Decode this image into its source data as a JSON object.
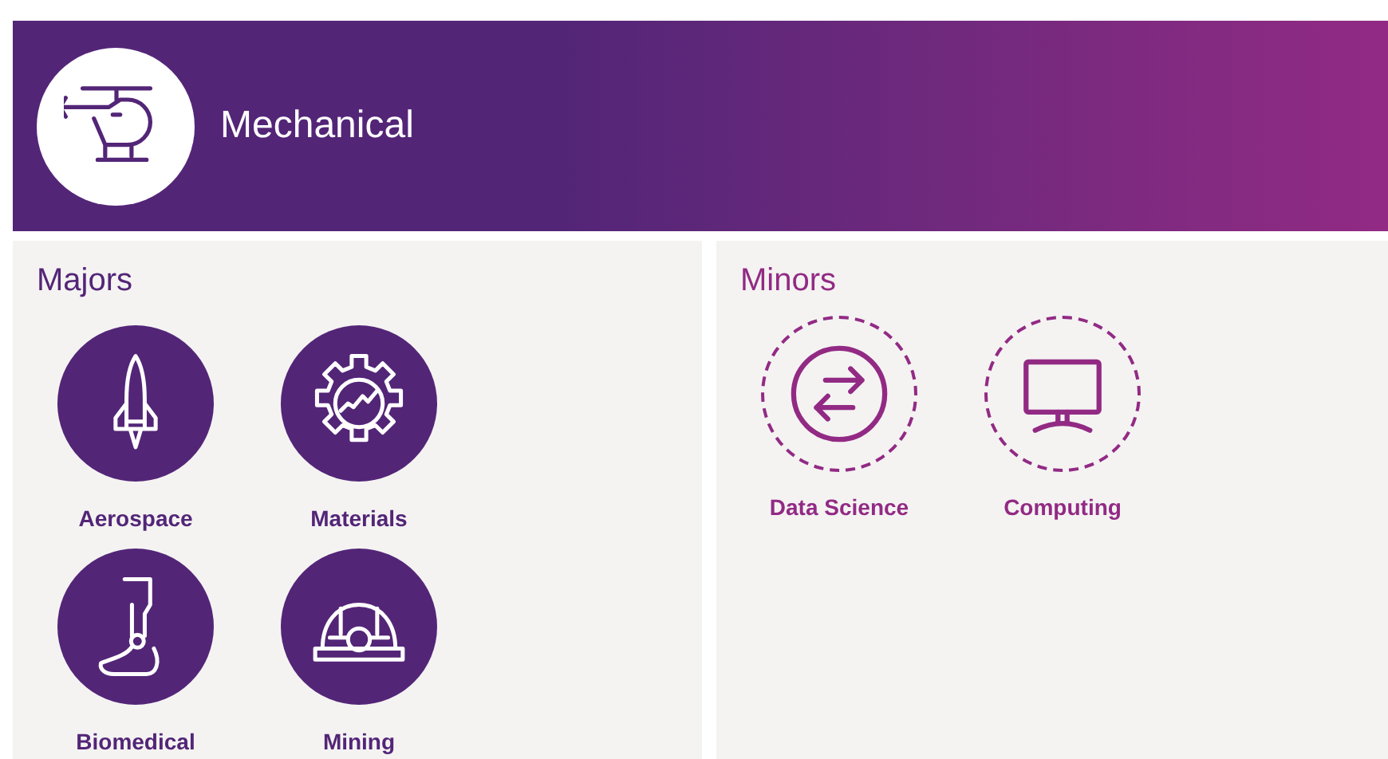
{
  "header": {
    "title": "Mechanical",
    "kind": "helicopter"
  },
  "majors": {
    "heading": "Majors",
    "items": [
      {
        "label": "Aerospace",
        "kind": "rocket"
      },
      {
        "label": "Materials",
        "kind": "gear"
      },
      {
        "label": "Biomedical",
        "kind": "prosthetic"
      },
      {
        "label": "Mining",
        "kind": "helmet"
      }
    ]
  },
  "minors": {
    "heading": "Minors",
    "items": [
      {
        "label": "Data Science",
        "kind": "exchange"
      },
      {
        "label": "Computing",
        "kind": "monitor"
      }
    ]
  }
}
